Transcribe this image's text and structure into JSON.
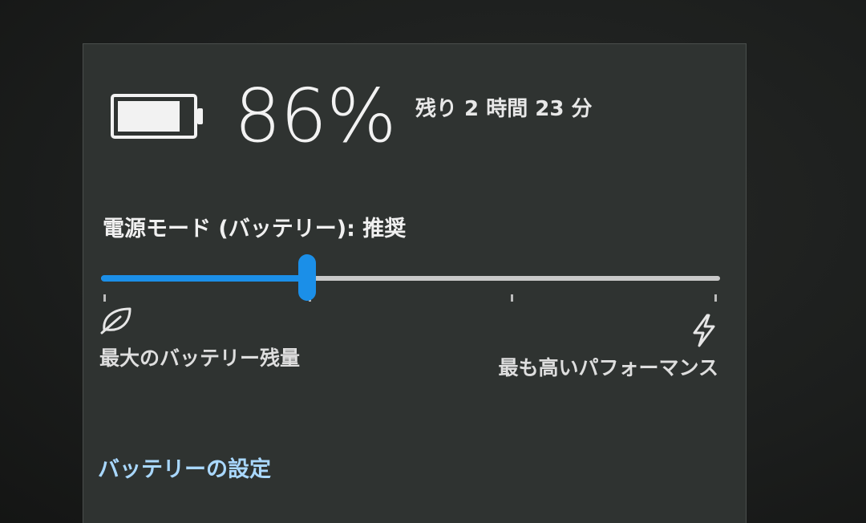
{
  "battery": {
    "icon": "battery-icon",
    "level": 0.86,
    "percent_text": "86%",
    "remaining_text": "残り 2 時間 23 分"
  },
  "power_mode": {
    "label": "電源モード (バッテリー): 推奨",
    "slider": {
      "steps": 4,
      "selected_step": 1,
      "fill_color": "#1b8fe8",
      "track_color": "#c9c9c9"
    },
    "left_icon": "leaf-icon",
    "left_caption": "最大のバッテリー残量",
    "right_icon": "lightning-bolt-icon",
    "right_caption": "最も高いパフォーマンス"
  },
  "settings_link": "バッテリーの設定",
  "colors": {
    "panel_background": "#2f3331",
    "link": "#a9d8ff",
    "accent": "#1b8fe8"
  }
}
